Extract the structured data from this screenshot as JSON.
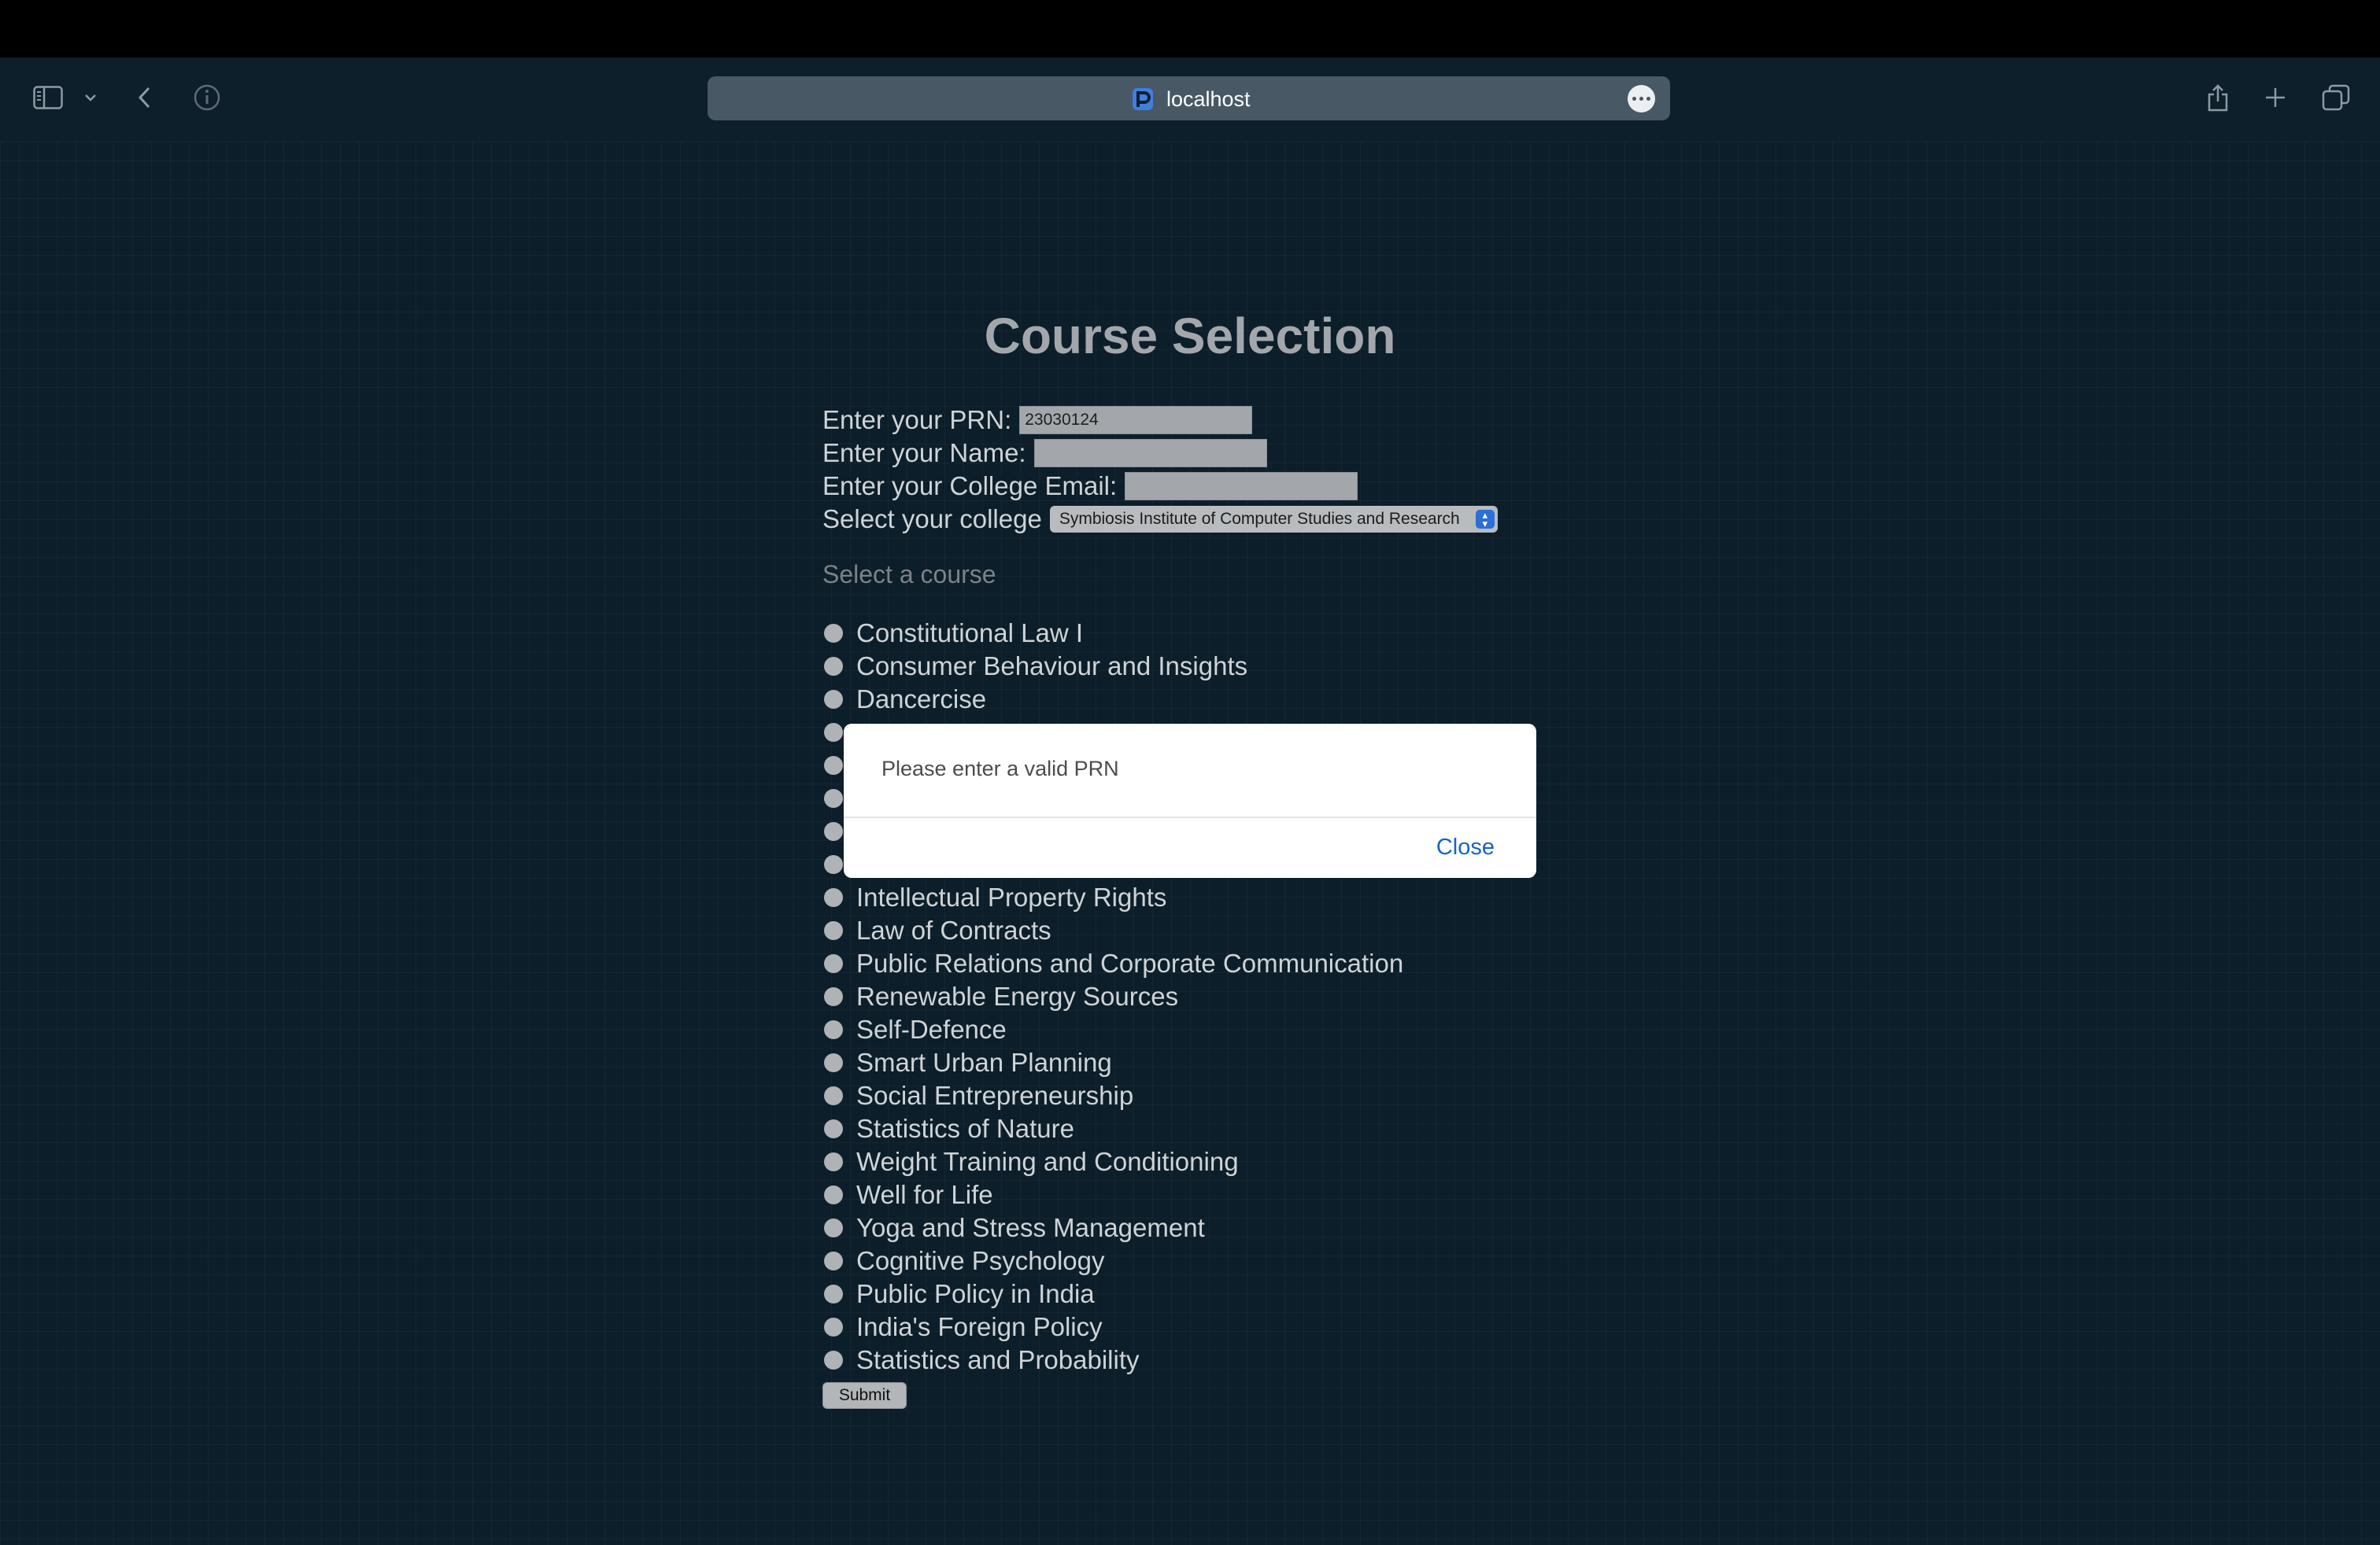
{
  "browser": {
    "address": "localhost"
  },
  "page": {
    "title": "Course Selection",
    "prn_label": "Enter your PRN:",
    "prn_value": "23030124",
    "name_label": "Enter your Name:",
    "name_value": "",
    "email_label": "Enter your College Email:",
    "email_value": "",
    "college_label": "Select your college",
    "college_selected": "Symbiosis Institute of Computer Studies and Research",
    "course_heading": "Select a course",
    "courses": [
      "Constitutional Law I",
      "Consumer Behaviour and Insights",
      "Dancercise",
      "",
      "",
      "",
      "",
      "",
      "Intellectual Property Rights",
      "Law of Contracts",
      "Public Relations and Corporate Communication",
      "Renewable Energy Sources",
      "Self-Defence",
      "Smart Urban Planning",
      "Social Entrepreneurship",
      "Statistics of Nature",
      "Weight Training and Conditioning",
      "Well for Life",
      "Yoga and Stress Management",
      "Cognitive Psychology",
      "Public Policy in India",
      "India's Foreign Policy",
      "Statistics and Probability"
    ],
    "submit_label": "Submit"
  },
  "modal": {
    "message": "Please enter a valid PRN",
    "close_label": "Close"
  }
}
